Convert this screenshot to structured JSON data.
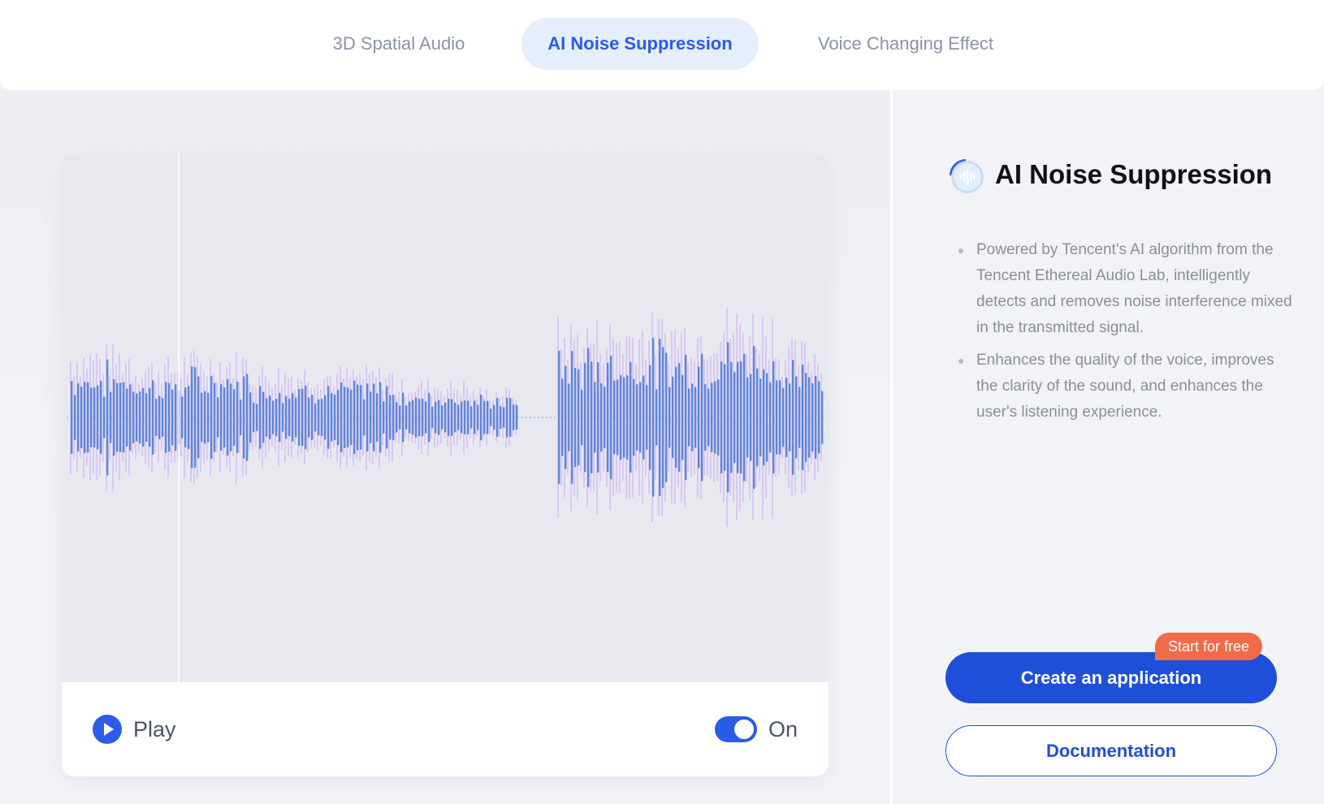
{
  "tabs": [
    {
      "label": "3D Spatial Audio",
      "active": false
    },
    {
      "label": "AI Noise Suppression",
      "active": true
    },
    {
      "label": "Voice Changing Effect",
      "active": false
    }
  ],
  "player": {
    "play_label": "Play",
    "toggle_label": "On",
    "toggle_on": true
  },
  "feature": {
    "title": "AI Noise Suppression",
    "icon": "sound-wave-icon",
    "bullets": [
      "Powered by Tencent's AI algorithm from the Tencent Ethereal Audio Lab, intelligently detects and removes noise interference mixed in the transmitted signal.",
      "Enhances the quality of the voice, improves the clarity of the sound, and enhances the user's listening experience."
    ]
  },
  "cta": {
    "badge": "Start for free",
    "primary": "Create an application",
    "secondary": "Documentation"
  },
  "colors": {
    "accent": "#1f4fd8",
    "badge": "#f16b4a",
    "wave_clean": "#5d86d8",
    "wave_noise": "#d9c7f5"
  }
}
